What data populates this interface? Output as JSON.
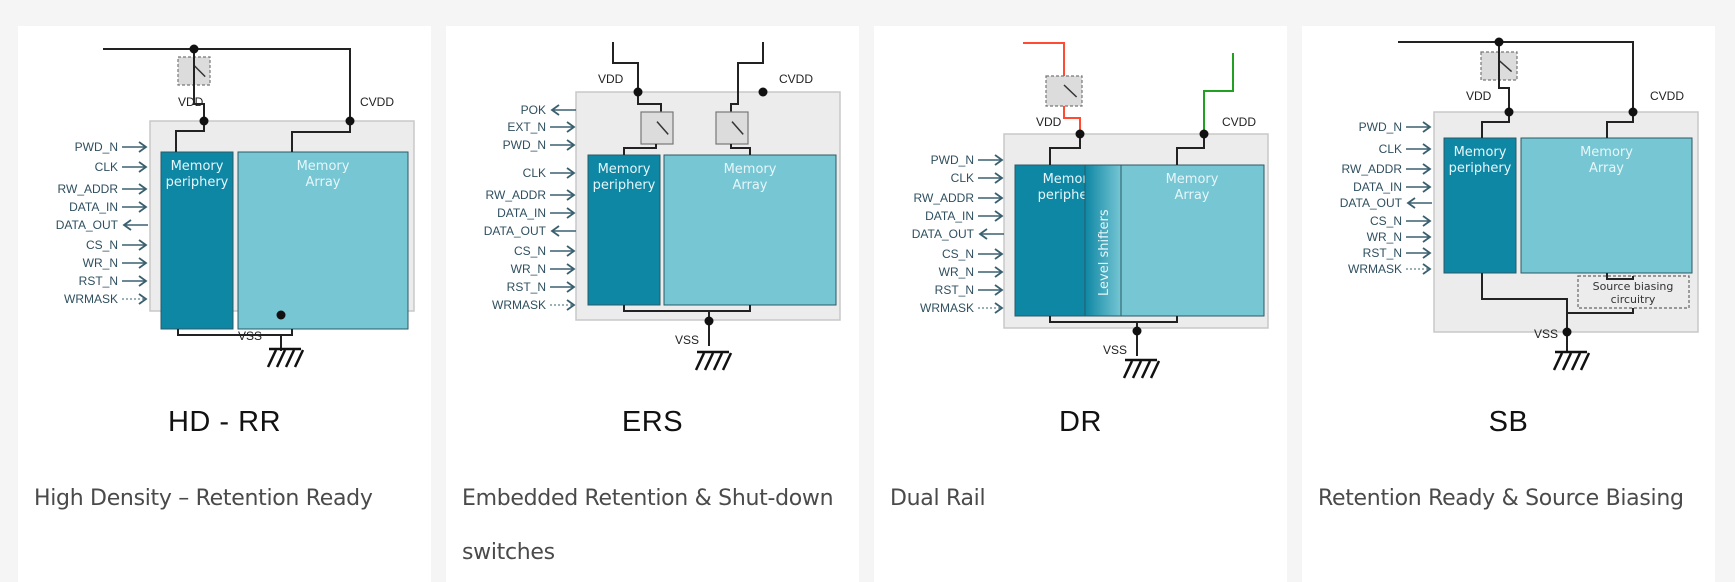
{
  "colors": {
    "page_bg": "#f5f5f5",
    "card_bg": "#ffffff",
    "periphery": "#0e87a4",
    "array": "#76c6d3",
    "container": "#ececec",
    "signal": "#2f4f5f",
    "wire": "#222222",
    "red_rail": "#ff4b33",
    "green_rail": "#22a022"
  },
  "cards": [
    {
      "variant": "HD - RR",
      "caption": "High Density – Retention Ready",
      "labels": {
        "vdd": "VDD",
        "cvdd": "CVDD",
        "vss": "VSS",
        "periphery": [
          "Memory",
          "periphery"
        ],
        "array": [
          "Memory",
          "Array"
        ]
      },
      "signals": [
        {
          "name": "PWD_N",
          "dir": "in"
        },
        {
          "name": "CLK",
          "dir": "in"
        },
        {
          "name": "RW_ADDR",
          "dir": "in"
        },
        {
          "name": "DATA_IN",
          "dir": "in"
        },
        {
          "name": "DATA_OUT",
          "dir": "out"
        },
        {
          "name": "CS_N",
          "dir": "in"
        },
        {
          "name": "WR_N",
          "dir": "in"
        },
        {
          "name": "RST_N",
          "dir": "in"
        },
        {
          "name": "WRMASK",
          "dir": "in-dashed"
        }
      ]
    },
    {
      "variant": "ERS",
      "caption": "Embedded Retention & Shut-down switches",
      "labels": {
        "vdd": "VDD",
        "cvdd": "CVDD",
        "vss": "VSS",
        "periphery": [
          "Memory",
          "periphery"
        ],
        "array": [
          "Memory",
          "Array"
        ]
      },
      "signals": [
        {
          "name": "POK",
          "dir": "out"
        },
        {
          "name": "EXT_N",
          "dir": "in"
        },
        {
          "name": "PWD_N",
          "dir": "in"
        },
        {
          "name": "CLK",
          "dir": "in"
        },
        {
          "name": "RW_ADDR",
          "dir": "in"
        },
        {
          "name": "DATA_IN",
          "dir": "in"
        },
        {
          "name": "DATA_OUT",
          "dir": "out"
        },
        {
          "name": "CS_N",
          "dir": "in"
        },
        {
          "name": "WR_N",
          "dir": "in"
        },
        {
          "name": "RST_N",
          "dir": "in"
        },
        {
          "name": "WRMASK",
          "dir": "in-dashed"
        }
      ]
    },
    {
      "variant": "DR",
      "caption": "Dual Rail",
      "labels": {
        "vdd": "VDD",
        "cvdd": "CVDD",
        "vss": "VSS",
        "periphery": [
          "Memory",
          "periphery"
        ],
        "array": [
          "Memory",
          "Array"
        ],
        "level_shifters": "Level shifters"
      },
      "signals": [
        {
          "name": "PWD_N",
          "dir": "in"
        },
        {
          "name": "CLK",
          "dir": "in"
        },
        {
          "name": "RW_ADDR",
          "dir": "in"
        },
        {
          "name": "DATA_IN",
          "dir": "in"
        },
        {
          "name": "DATA_OUT",
          "dir": "out"
        },
        {
          "name": "CS_N",
          "dir": "in"
        },
        {
          "name": "WR_N",
          "dir": "in"
        },
        {
          "name": "RST_N",
          "dir": "in"
        },
        {
          "name": "WRMASK",
          "dir": "in-dashed"
        }
      ]
    },
    {
      "variant": "SB",
      "caption": "Retention Ready & Source Biasing",
      "labels": {
        "vdd": "VDD",
        "cvdd": "CVDD",
        "vss": "VSS",
        "periphery": [
          "Memory",
          "periphery"
        ],
        "array": [
          "Memory",
          "Array"
        ],
        "source_biasing": [
          "Source biasing",
          "circuitry"
        ]
      },
      "signals": [
        {
          "name": "PWD_N",
          "dir": "in"
        },
        {
          "name": "CLK",
          "dir": "in"
        },
        {
          "name": "RW_ADDR",
          "dir": "in"
        },
        {
          "name": "DATA_IN",
          "dir": "in"
        },
        {
          "name": "DATA_OUT",
          "dir": "out"
        },
        {
          "name": "CS_N",
          "dir": "in"
        },
        {
          "name": "WR_N",
          "dir": "in"
        },
        {
          "name": "RST_N",
          "dir": "in"
        },
        {
          "name": "WRMASK",
          "dir": "in-dashed"
        }
      ]
    }
  ]
}
